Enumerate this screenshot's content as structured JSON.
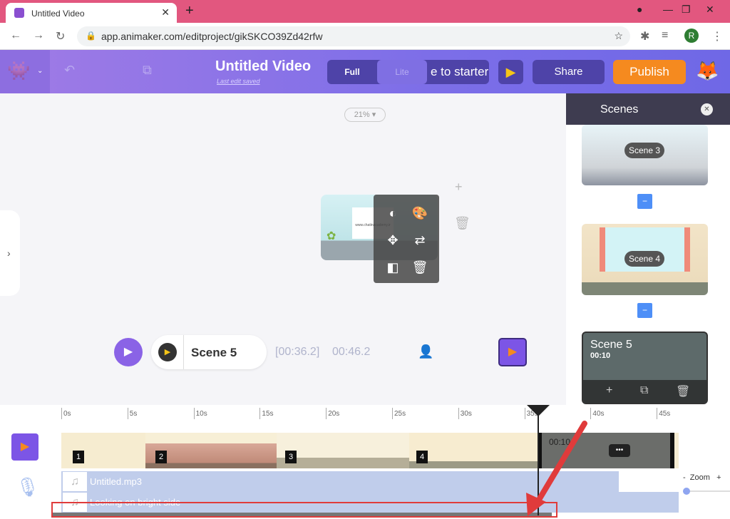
{
  "browser": {
    "tab_title": "Untitled Video",
    "url": "app.animaker.com/editproject/gikSKCO39Zd42rfw",
    "profile_initial": "R"
  },
  "header": {
    "title": "Untitled Video",
    "saved": "Last edit saved",
    "mode_full": "Full",
    "mode_lite": "Lite",
    "starter_label": "e to starter",
    "share": "Share",
    "publish": "Publish"
  },
  "canvas": {
    "zoom": "21%",
    "watermark": "www.chatinacademy.ir",
    "scene_name": "Scene 5",
    "time_current": "[00:36.2]",
    "time_total": "00:46.2"
  },
  "scenes_panel": {
    "title": "Scenes",
    "scenes": [
      {
        "label": "Scene 3"
      },
      {
        "label": "Scene 4"
      },
      {
        "label": "Scene 5",
        "duration": "00:10"
      }
    ],
    "minus": "−"
  },
  "timeline": {
    "ticks": [
      "0s",
      "5s",
      "10s",
      "15s",
      "20s",
      "25s",
      "30s",
      "35s",
      "40s",
      "45s"
    ],
    "scene_numbers": [
      "1",
      "2",
      "3",
      "4"
    ],
    "active_scene_time": "00:10",
    "more": "•••",
    "audio_tracks": [
      "Untitled.mp3",
      "Looking on bright side"
    ],
    "zoom_label": "Zoom",
    "zoom_minus": "-",
    "zoom_plus": "+",
    "zoom_level": 0
  },
  "colors": {
    "brand": "#7c6ee8",
    "publish": "#f58a1f",
    "highlight": "#e03b3b"
  }
}
